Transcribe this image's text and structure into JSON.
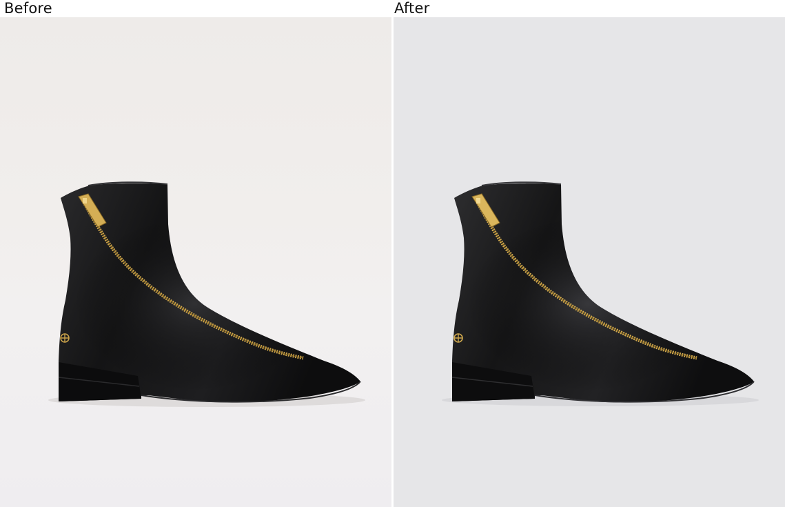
{
  "labels": {
    "before": "Before",
    "after": "After"
  },
  "colors": {
    "before_background": "#efedec",
    "after_background": "#e6e6e8",
    "boot_leather": "#101011",
    "zipper": "#c9a24a"
  },
  "image": {
    "subject": "black-leather-ankle-boot-with-diagonal-gold-zipper"
  }
}
